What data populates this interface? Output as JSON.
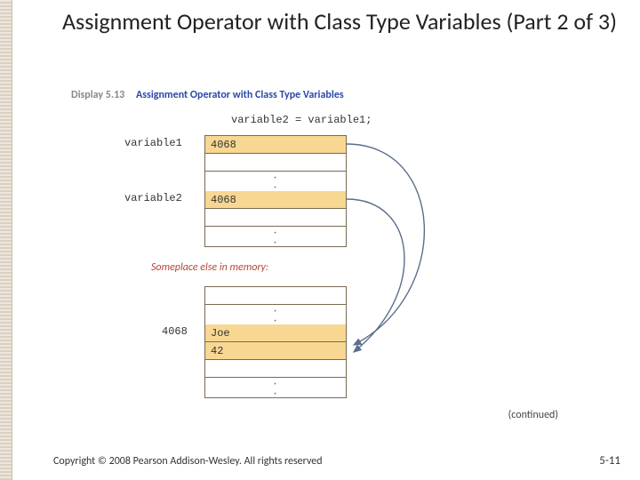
{
  "title": "Assignment Operator with Class Type Variables (Part 2 of 3)",
  "display_label": "Display 5.13",
  "caption": "Assignment Operator with Class Type Variables",
  "statement": "variable2 = variable1;",
  "var1_label": "variable1",
  "var2_label": "variable2",
  "addr1": "4068",
  "addr2": "4068",
  "someplace": "Someplace else in memory:",
  "obj_addr": "4068",
  "obj_name": "Joe",
  "obj_age": "42",
  "continued": "(continued)",
  "copyright": "Copyright © 2008 Pearson Addison-Wesley. All rights reserved",
  "pagenum": "5-11"
}
